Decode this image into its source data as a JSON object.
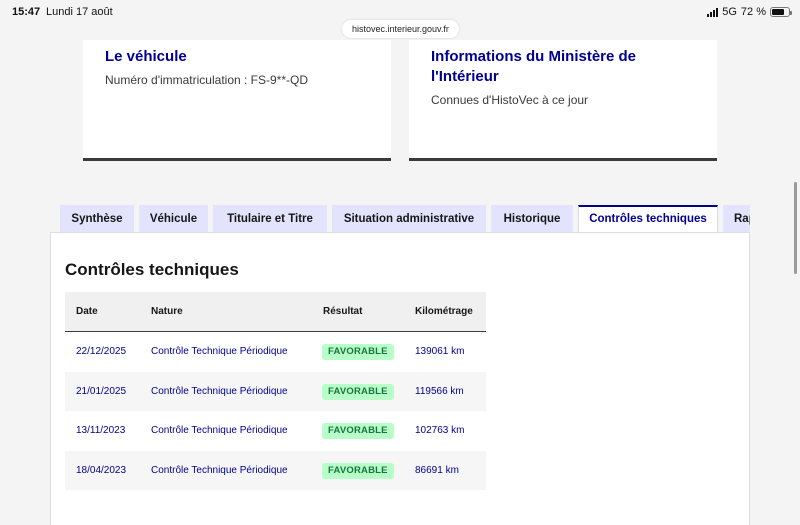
{
  "status_bar": {
    "time": "15:47",
    "date": "Lundi 17 août",
    "network": "5G",
    "battery": "72 %",
    "battery_level": 0.72
  },
  "browser": {
    "url": "histovec.interieur.gouv.fr"
  },
  "cards": {
    "vehicle": {
      "title": "Le véhicule",
      "description": "Numéro d'immatriculation : FS-9**-QD"
    },
    "ministry": {
      "title": "Informations du Ministère de l'Intérieur",
      "description": "Connues d'HistoVec à ce jour"
    }
  },
  "tabs": [
    {
      "label": "Synthèse",
      "active": false
    },
    {
      "label": "Véhicule",
      "active": false
    },
    {
      "label": "Titulaire et Titre",
      "active": false
    },
    {
      "label": "Situation administrative",
      "active": false
    },
    {
      "label": "Historique",
      "active": false
    },
    {
      "label": "Contrôles techniques",
      "active": true
    },
    {
      "label": "Rap",
      "active": false
    }
  ],
  "panel": {
    "title": "Contrôles techniques",
    "table": {
      "headers": [
        "Date",
        "Nature",
        "Résultat",
        "Kilométrage"
      ],
      "rows": [
        {
          "date": "22/12/2025",
          "nature": "Contrôle Technique Périodique",
          "result": "FAVORABLE",
          "km": "139061 km"
        },
        {
          "date": "21/01/2025",
          "nature": "Contrôle Technique Périodique",
          "result": "FAVORABLE",
          "km": "119566 km"
        },
        {
          "date": "13/11/2023",
          "nature": "Contrôle Technique Périodique",
          "result": "FAVORABLE",
          "km": "102763 km"
        },
        {
          "date": "18/04/2023",
          "nature": "Contrôle Technique Périodique",
          "result": "FAVORABLE",
          "km": "86691 km"
        }
      ]
    }
  },
  "colors": {
    "primary_blue": "#000091",
    "tab_bg": "#e3e3fd",
    "badge_bg": "#b8fec9",
    "badge_text": "#18753c"
  }
}
